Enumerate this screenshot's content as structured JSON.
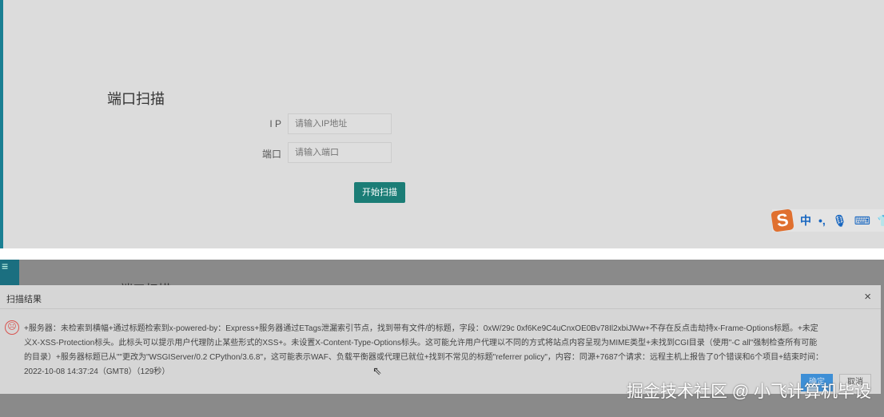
{
  "form": {
    "title": "端口扫描",
    "ip_label": "I P",
    "ip_placeholder": "请输入IP地址",
    "port_label": "端口",
    "port_placeholder": "请输入端口",
    "submit": "开始扫描"
  },
  "ime": {
    "logo": "S",
    "mode": "中",
    "punct": "•,",
    "mic": "🎙",
    "keyboard": "⌨",
    "skin": "👕"
  },
  "background_title": "端口扫描",
  "menu_icon": "≡",
  "dialog": {
    "title": "扫描结果",
    "close": "×",
    "message": "+服务器：未检索到横幅+通过标题检索到x-powered-by：Express+服务器通过ETags泄漏索引节点，找到带有文件/的标题，字段：0xW/29c 0xf6Ke9C4uCnxOE0Bv78Il2xbiJWw+不存在反点击劫持x-Frame-Options标题。+未定义X-XSS-Protection标头。此标头可以提示用户代理防止某些形式的XSS+。未设置X-Content-Type-Options标头。这可能允许用户代理以不同的方式将站点内容呈现为MIME类型+未找到CGI目录（使用\"-C all\"强制检查所有可能的目录）+服务器标题已从\"\"更改为\"WSGIServer/0.2 CPython/3.6.8\"，这可能表示WAF、负载平衡器或代理已就位+找到不常见的标题\"referrer policy\"，内容：同源+7687个请求：远程主机上报告了0个错误和6个项目+结束时间：2022-10-08 14:37:24（GMT8）（129秒）",
    "ok": "确定",
    "cancel": "取消"
  },
  "watermark": "掘金技术社区 @ 小飞计算机毕设"
}
